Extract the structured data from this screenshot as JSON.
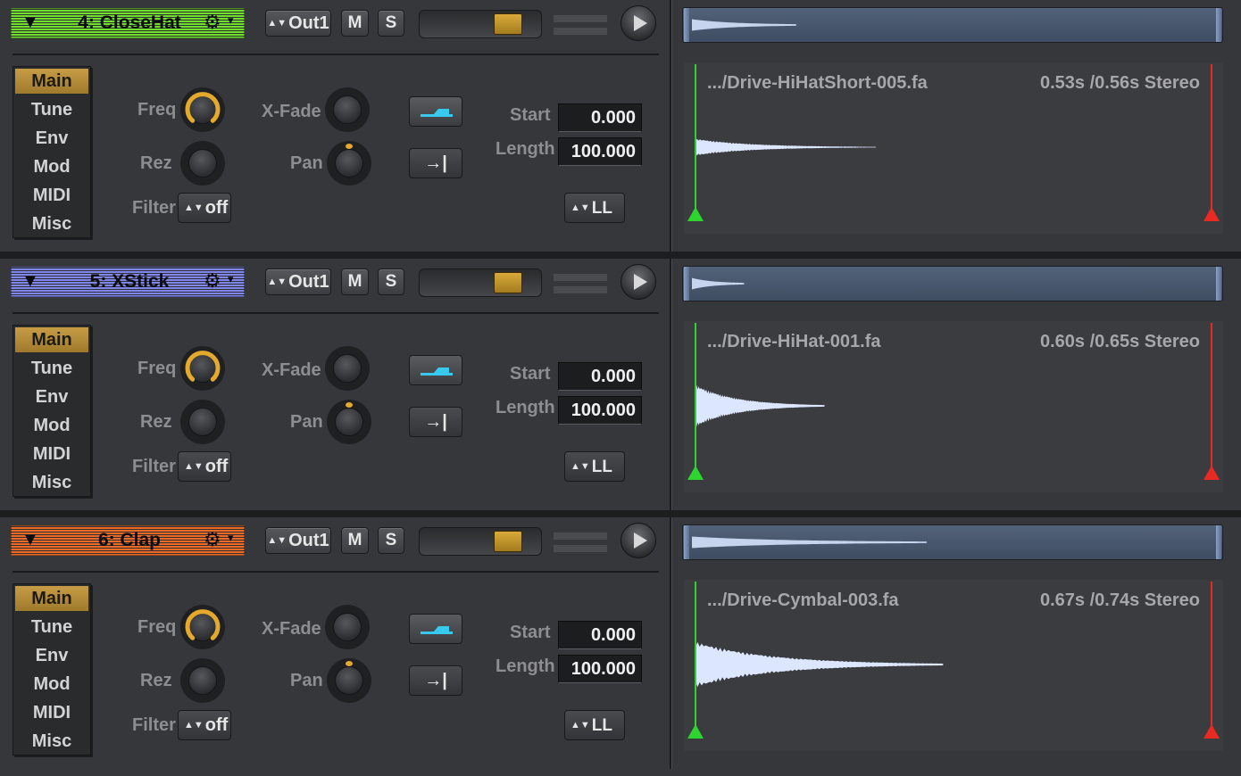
{
  "colors": {
    "accent_gold": "#d9a93a",
    "active_tab": "#c79c45",
    "start_marker": "#2fd52f",
    "end_marker": "#e82a22",
    "waveform": "#dce6ff",
    "mode_arrow": "#38c9ee"
  },
  "labels": {
    "freq": "Freq",
    "rez": "Rez",
    "filter": "Filter",
    "xfade": "X-Fade",
    "pan": "Pan",
    "start": "Start",
    "length": "Length",
    "out": "Out1",
    "mute": "M",
    "solo": "S",
    "end_mode": "→|",
    "collapse": "▼",
    "gear": "⚙",
    "gear_caret": "▾",
    "select_arrows": "▲▼"
  },
  "tabs": [
    "Main",
    "Tune",
    "Env",
    "Mod",
    "MIDI",
    "Misc"
  ],
  "tracks": [
    {
      "name": "4: CloseHat",
      "color": "#6fe02c",
      "file": ".../Drive-HiHatShort-005.fa",
      "info": "0.53s /0.56s Stereo",
      "start": "0.000",
      "length": "100.000",
      "filter": "off",
      "loop_mode": "LL",
      "active_tab": "Main",
      "volume_percent": 80,
      "waveform": {
        "peak": 0.1,
        "decay_end": 0.35,
        "overview_end": 0.2
      }
    },
    {
      "name": "5: XStick",
      "color": "#7f86ee",
      "file": ".../Drive-HiHat-001.fa",
      "info": "0.60s /0.65s Stereo",
      "start": "0.000",
      "length": "100.000",
      "filter": "off",
      "loop_mode": "LL",
      "active_tab": "Main",
      "volume_percent": 80,
      "waveform": {
        "peak": 0.25,
        "decay_end": 0.25,
        "overview_end": 0.1
      }
    },
    {
      "name": "6: Clap",
      "color": "#ef6a24",
      "file": ".../Drive-Cymbal-003.fa",
      "info": "0.67s /0.74s Stereo",
      "start": "0.000",
      "length": "100.000",
      "filter": "off",
      "loop_mode": "LL",
      "active_tab": "Main",
      "volume_percent": 80,
      "waveform": {
        "peak": 0.27,
        "decay_end": 0.48,
        "overview_end": 0.45
      }
    }
  ]
}
